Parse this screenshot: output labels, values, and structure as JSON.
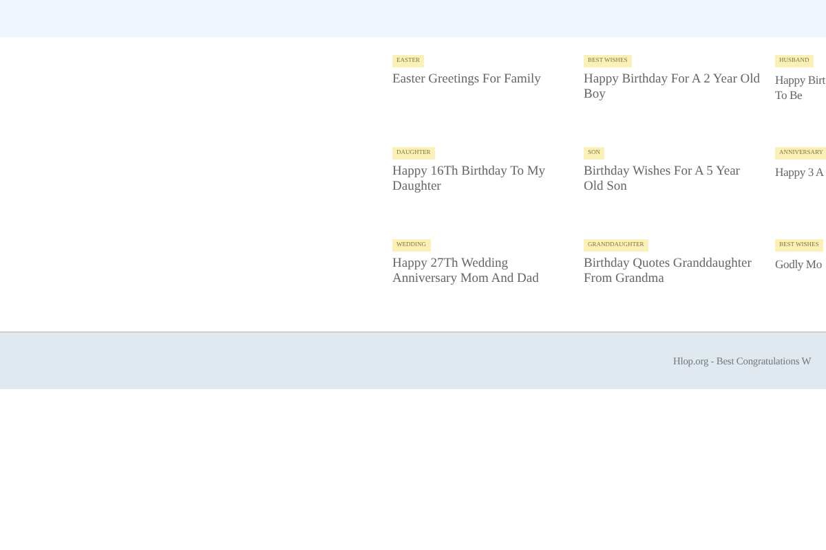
{
  "posts": [
    {
      "tag": "EASTER",
      "title": "Easter Greetings For Family"
    },
    {
      "tag": "BEST WISHES",
      "title": "Happy Birthday For A 2 Year Old Boy"
    },
    {
      "tag": "HUSBAND",
      "title": "Happy Birt\nTo Be"
    },
    {
      "tag": "DAUGHTER",
      "title": "Happy 16Th Birthday To My Daughter"
    },
    {
      "tag": "SON",
      "title": "Birthday Wishes For A 5 Year Old Son"
    },
    {
      "tag": "ANNIVERSARY",
      "title": "Happy 3 A"
    },
    {
      "tag": "WEDDING",
      "title": "Happy 27Th Wedding Anniversary Mom And Dad"
    },
    {
      "tag": "GRANDDAUGHTER",
      "title": "Birthday Quotes Granddaughter From Grandma"
    },
    {
      "tag": "BEST WISHES",
      "title": "Godly Mo"
    }
  ],
  "footer": {
    "text": "Hlop.org - Best Congratulations W"
  }
}
